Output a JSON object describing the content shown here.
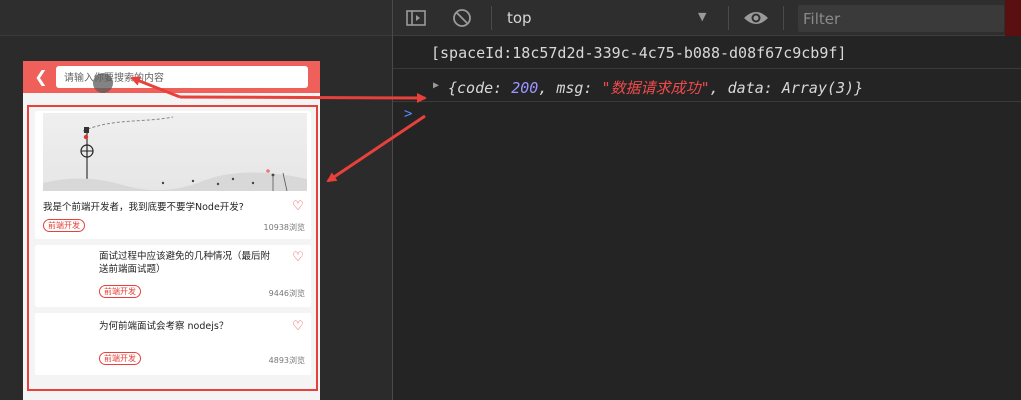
{
  "colors": {
    "accent": "#e8403a",
    "header": "#f0605a",
    "panel_bg": "#242424",
    "number": "#9a94ff",
    "string": "#ef4a4a",
    "prompt": "#4f8cff"
  },
  "phone": {
    "back_icon": "chevron-left-icon",
    "search": {
      "placeholder": "请输入你要搜索的内容"
    },
    "articles": [
      {
        "title": "我是个前端开发者，我到底要不要学Node开发?",
        "tag": "前端开发",
        "views": "10938浏览",
        "has_image": true
      },
      {
        "title": "面试过程中应该避免的几种情况（最后附送前端面试题）",
        "tag": "前端开发",
        "views": "9446浏览",
        "has_image": false
      },
      {
        "title": "为何前端面试会考察 nodejs？",
        "tag": "前端开发",
        "views": "4893浏览",
        "has_image": false
      }
    ]
  },
  "devtools": {
    "toolbar": {
      "sidebar_icon": "sidebar-toggle-icon",
      "clear_icon": "clear-console-icon",
      "context": "top",
      "eye_icon": "eye-icon",
      "filter_placeholder": "Filter"
    },
    "console": {
      "line1": "[spaceId:18c57d2d-339c-4c75-b088-d08f67c9cb9f]",
      "line2": {
        "open": "{",
        "code_key": "code: ",
        "code_val": "200",
        "msg_key": ", msg: ",
        "msg_val": "\"数据请求成功\"",
        "data_key": ", data: ",
        "data_val": "Array(3)",
        "close": "}"
      },
      "prompt": ">"
    }
  }
}
